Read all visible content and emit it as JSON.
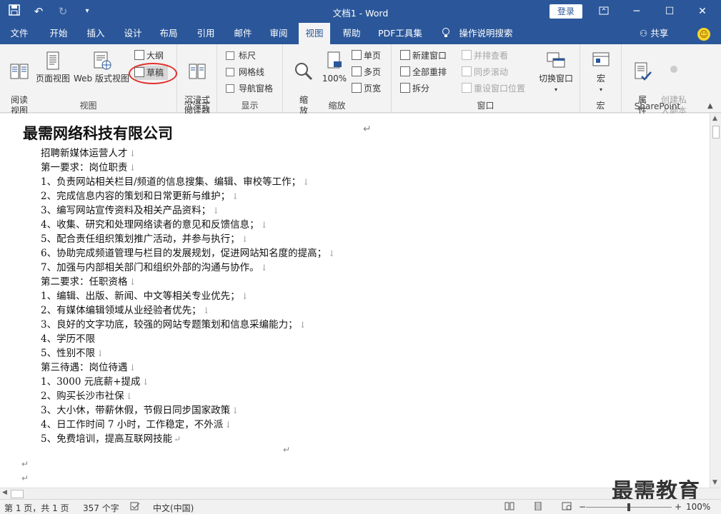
{
  "titlebar": {
    "title": "文档1  -  Word",
    "login_label": "登录",
    "qat_icons": [
      "save-icon",
      "undo-icon",
      "redo-icon",
      "customize-qat-icon"
    ]
  },
  "tabs": [
    {
      "label": "文件"
    },
    {
      "label": "开始"
    },
    {
      "label": "插入"
    },
    {
      "label": "设计"
    },
    {
      "label": "布局"
    },
    {
      "label": "引用"
    },
    {
      "label": "邮件"
    },
    {
      "label": "审阅"
    },
    {
      "label": "视图",
      "active": true
    },
    {
      "label": "帮助"
    },
    {
      "label": "PDF工具集"
    },
    {
      "label": "操作说明搜索"
    }
  ],
  "share_label": "共享",
  "ribbon": {
    "view_group": {
      "label": "视图",
      "read_mode": "阅读\n视图",
      "print_layout": "页面视图",
      "web_layout": "Web 版式视图",
      "outline": "大纲",
      "draft": "草稿"
    },
    "immersive_group": {
      "label": "沉浸式",
      "reader": "沉浸式\n阅读器"
    },
    "show_group": {
      "label": "显示",
      "ruler": "标尺",
      "gridlines": "网格线",
      "nav_pane": "导航窗格"
    },
    "zoom_group": {
      "label": "缩放",
      "zoom": "缩\n放",
      "hundred": "100%",
      "one_page": "单页",
      "multi_page": "多页",
      "page_width": "页宽"
    },
    "window_group": {
      "label": "窗口",
      "new_window": "新建窗口",
      "arrange_all": "全部重排",
      "split": "拆分",
      "side_by_side": "并排查看",
      "sync_scroll": "同步滚动",
      "reset_pos": "重设窗口位置",
      "switch_window": "切换窗口"
    },
    "macro_group": {
      "label": "宏",
      "macros": "宏"
    },
    "sharepoint_group": {
      "label": "SharePoint",
      "properties": "属\n性",
      "create_private": "创建私\n人副本"
    }
  },
  "document": {
    "company": "最需网络科技有限公司",
    "lines": [
      {
        "text": "招聘新媒体运营人才",
        "mark": "↓"
      },
      {
        "text": "第一要求：岗位职责",
        "mark": "↓"
      },
      {
        "text": "1、负责网站相关栏目/频道的信息搜集、编辑、审校等工作；",
        "mark": "↓"
      },
      {
        "text": "2、完成信息内容的策划和日常更新与维护；",
        "mark": "↓"
      },
      {
        "text": "3、编写网站宣传资料及相关产品资料；",
        "mark": "↓"
      },
      {
        "text": "4、收集、研究和处理网络读者的意见和反馈信息；",
        "mark": "↓"
      },
      {
        "text": "5、配合责任组织策划推广活动，并参与执行；",
        "mark": "↓"
      },
      {
        "text": "6、协助完成频道管理与栏目的发展规划，促进网站知名度的提高；",
        "mark": "↓"
      },
      {
        "text": "7、加强与内部相关部门和组织外部的沟通与协作。",
        "mark": "↓"
      },
      {
        "text": "第二要求：任职资格",
        "mark": "↓"
      },
      {
        "text": "1、编辑、出版、新闻、中文等相关专业优先；",
        "mark": "↓"
      },
      {
        "text": "2、有媒体编辑领域从业经验者优先；",
        "mark": "↓"
      },
      {
        "text": "3、良好的文字功底，较强的网站专题策划和信息采编能力；",
        "mark": "↓"
      },
      {
        "text": "4、学历不限",
        "mark": ""
      },
      {
        "text": "5、性别不限",
        "mark": "↓"
      },
      {
        "text": "第三待遇：岗位待遇",
        "mark": "↓"
      },
      {
        "text": "1、3000 元底薪+提成",
        "mark": "↓"
      },
      {
        "text": "2、购买长沙市社保",
        "mark": "↓"
      },
      {
        "text": "3、大小休，带薪休假，节假日同步国家政策",
        "mark": "↓"
      },
      {
        "text": "4、日工作时间 7 小时，工作稳定，不外派",
        "mark": "↓"
      },
      {
        "text": "5、免费培训，提高互联网技能",
        "mark": "↵"
      }
    ],
    "return_mark": "↵"
  },
  "watermark": "最需教育",
  "status": {
    "page": "第 1 页，共 1 页",
    "words": "357 个字",
    "language": "中文(中国)",
    "zoom": "100%",
    "zoom_fraction": 0.5
  }
}
